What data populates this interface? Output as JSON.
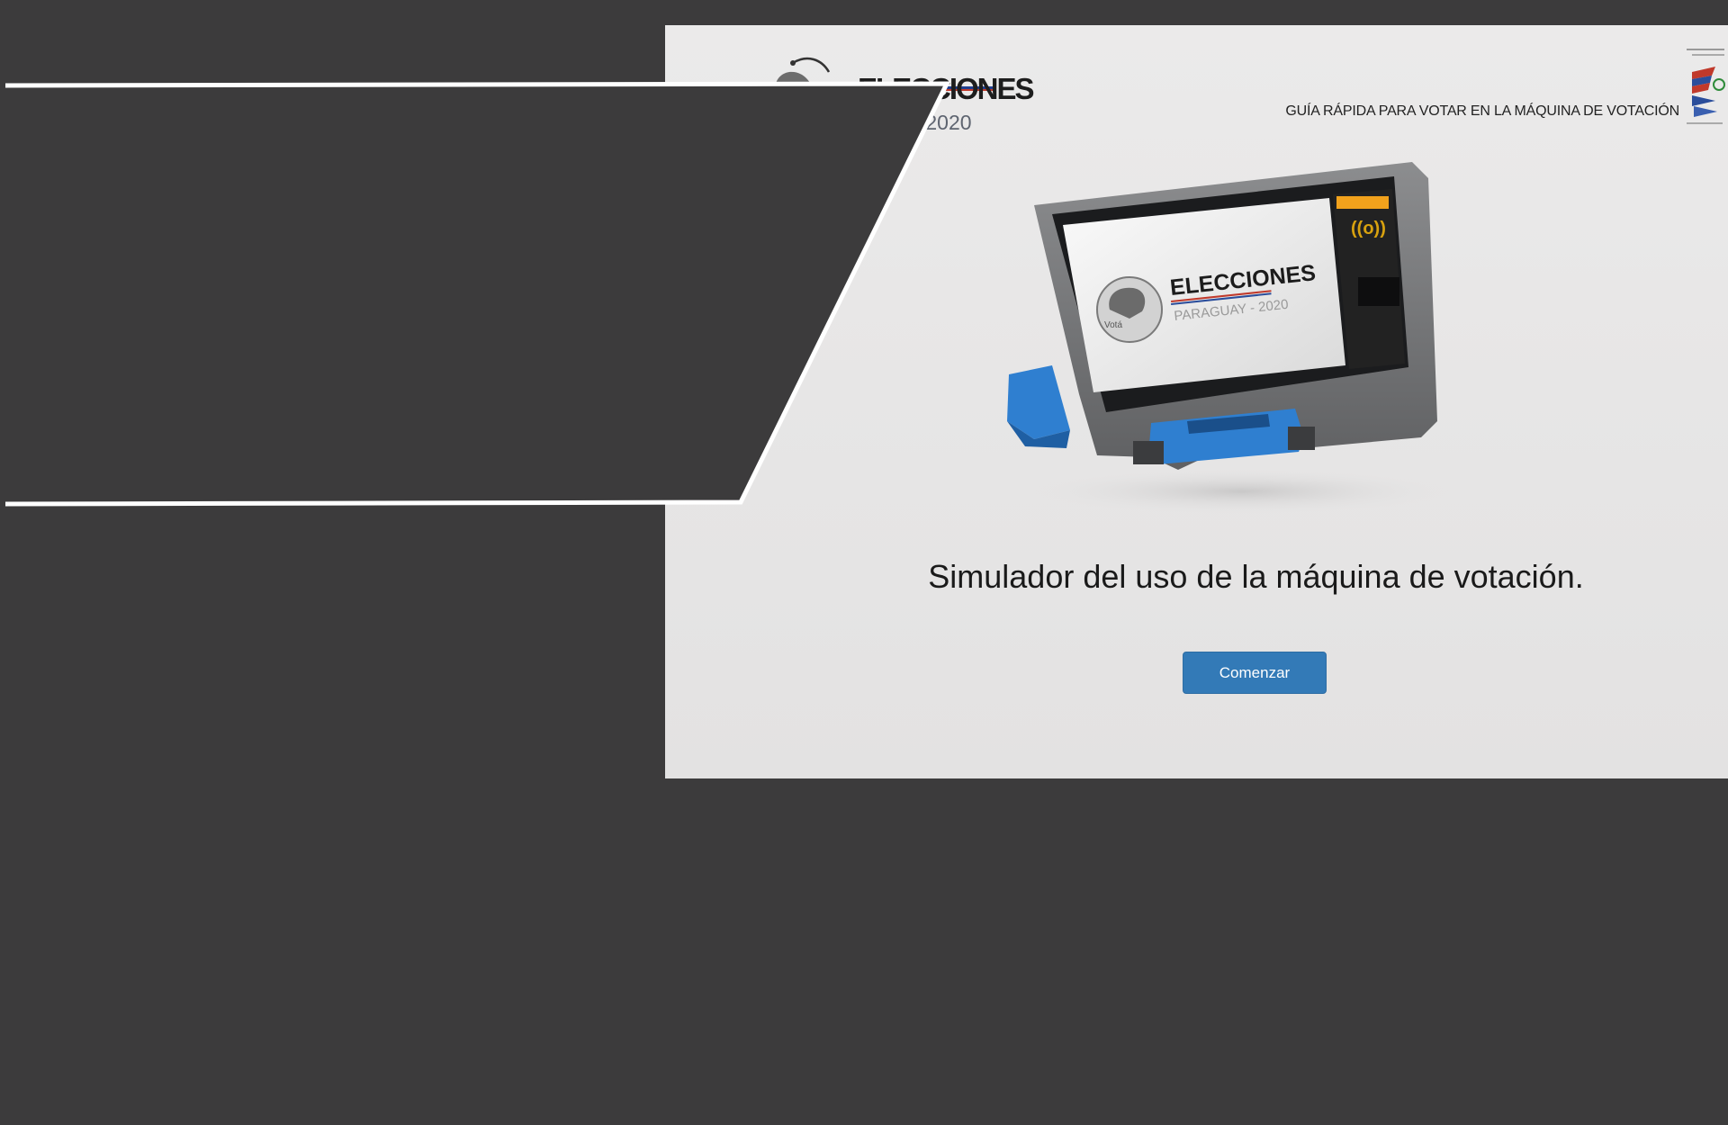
{
  "header": {
    "logo_title": "ELECCIONES",
    "logo_subtitle": "Y - 2020",
    "guide_title": "GUÍA RÁPIDA PARA VOTAR EN LA MÁQUINA DE VOTACIÓN"
  },
  "machine_screen": {
    "title": "ELECCIONES",
    "subtitle": "PARAGUAY - 2020",
    "vote_label": "Votá"
  },
  "main": {
    "headline": "Simulador del uso de la máquina de votación.",
    "start_label": "Comenzar"
  },
  "colors": {
    "background": "#3c3b3c",
    "page": "#e8e7e7",
    "button": "#337ab7",
    "accent_orange": "#f2a21c",
    "accent_blue": "#2f7fd0"
  }
}
